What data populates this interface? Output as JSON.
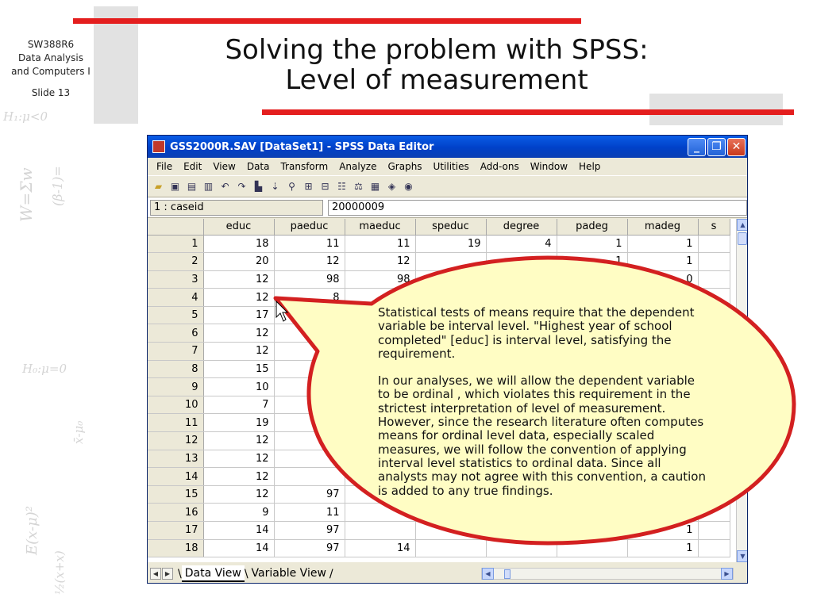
{
  "slide": {
    "course_lines": [
      "SW388R6",
      "Data Analysis",
      "and Computers I"
    ],
    "slide_number": "Slide 13",
    "title_line1": "Solving the problem with SPSS:",
    "title_line2": "Level of measurement"
  },
  "window": {
    "title": "GSS2000R.SAV [DataSet1] - SPSS Data Editor",
    "menu": [
      "File",
      "Edit",
      "View",
      "Data",
      "Transform",
      "Analyze",
      "Graphs",
      "Utilities",
      "Add-ons",
      "Window",
      "Help"
    ],
    "cell_ref": "1 : caseid",
    "cell_value": "20000009",
    "columns": [
      "educ",
      "paeduc",
      "maeduc",
      "speduc",
      "degree",
      "padeg",
      "madeg",
      "s"
    ],
    "rows": [
      [
        "1",
        "18",
        "11",
        "11",
        "19",
        "4",
        "1",
        "1",
        ""
      ],
      [
        "2",
        "20",
        "12",
        "12",
        "",
        "",
        "1",
        "1",
        ""
      ],
      [
        "3",
        "12",
        "98",
        "98",
        "",
        "",
        "",
        "0",
        ""
      ],
      [
        "4",
        "12",
        "8",
        "",
        "",
        "",
        "",
        "",
        ""
      ],
      [
        "5",
        "17",
        "",
        "",
        "",
        "",
        "",
        "",
        ""
      ],
      [
        "6",
        "12",
        "",
        "",
        "",
        "",
        "",
        "",
        ""
      ],
      [
        "7",
        "12",
        "",
        "",
        "",
        "",
        "",
        "",
        ""
      ],
      [
        "8",
        "15",
        "",
        "",
        "",
        "",
        "",
        "",
        ""
      ],
      [
        "9",
        "10",
        "",
        "",
        "",
        "",
        "",
        "",
        ""
      ],
      [
        "10",
        "7",
        "",
        "",
        "",
        "",
        "",
        "",
        ""
      ],
      [
        "11",
        "19",
        "",
        "",
        "",
        "",
        "",
        "",
        ""
      ],
      [
        "12",
        "12",
        "",
        "",
        "",
        "",
        "",
        "",
        ""
      ],
      [
        "13",
        "12",
        "",
        "",
        "",
        "",
        "",
        "",
        ""
      ],
      [
        "14",
        "12",
        "",
        "",
        "",
        "",
        "",
        "",
        ""
      ],
      [
        "15",
        "12",
        "97",
        "",
        "",
        "",
        "",
        "",
        ""
      ],
      [
        "16",
        "9",
        "11",
        "",
        "",
        "",
        "",
        "",
        ""
      ],
      [
        "17",
        "14",
        "97",
        "",
        "",
        "",
        "",
        "1",
        ""
      ],
      [
        "18",
        "14",
        "97",
        "14",
        "",
        "",
        "",
        "1",
        ""
      ]
    ],
    "tabs": [
      "Data View",
      "Variable View"
    ]
  },
  "callout": {
    "paragraph1": "Statistical tests of means require that the dependent variable be interval level. \"Highest year of school completed\" [educ] is interval level, satisfying the requirement.",
    "paragraph2": "In our analyses, we will allow the dependent variable to be ordinal , which violates this requirement in the strictest interpretation of level of measurement. However, since the research literature often computes means for ordinal level data, especially scaled measures, we will follow the convention of applying interval level statistics to ordinal data. Since all analysts may not agree with this convention, a caution is added to any true findings."
  }
}
